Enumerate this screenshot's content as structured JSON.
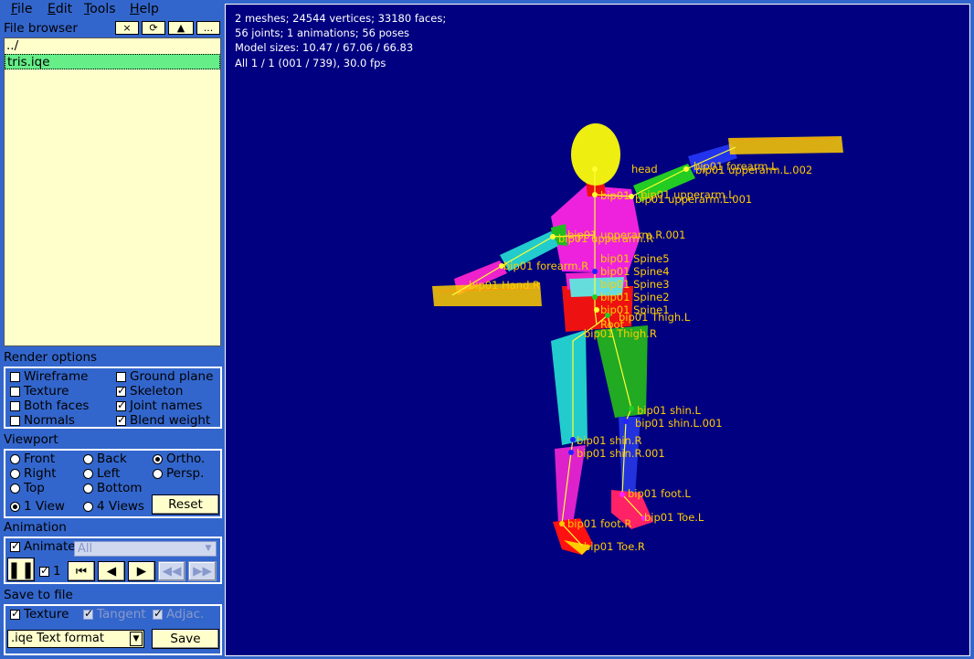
{
  "menu": {
    "file": "File",
    "edit": "Edit",
    "tools": "Tools",
    "help": "Help"
  },
  "file_browser": {
    "title": "File browser",
    "buttons": {
      "close": "×",
      "refresh": "⟳",
      "up": "▲",
      "more": "..."
    },
    "items": [
      "../",
      "tris.iqe"
    ],
    "selected": "tris.iqe"
  },
  "render_options": {
    "title": "Render options",
    "wireframe": "Wireframe",
    "ground_plane": "Ground plane",
    "texture": "Texture",
    "skeleton": "Skeleton",
    "both_faces": "Both faces",
    "joint_names": "Joint names",
    "normals": "Normals",
    "blend_weight": "Blend weight",
    "checked": {
      "wireframe": false,
      "ground_plane": false,
      "texture": false,
      "skeleton": true,
      "both_faces": false,
      "joint_names": true,
      "normals": false,
      "blend_weight": true
    }
  },
  "viewport": {
    "title": "Viewport",
    "front": "Front",
    "back": "Back",
    "ortho": "Ortho.",
    "right": "Right",
    "left": "Left",
    "persp": "Persp.",
    "top": "Top",
    "bottom": "Bottom",
    "one_view": "1 View",
    "four_views": "4 Views",
    "reset": "Reset",
    "selected_projection": "Ortho.",
    "selected_layout": "1 View"
  },
  "animation": {
    "title": "Animation",
    "animate_label": "Animate",
    "animate_checked": true,
    "select_value": "All",
    "speed_label": "1",
    "speed_checked": true
  },
  "save": {
    "title": "Save to file",
    "texture": "Texture",
    "texture_checked": true,
    "tangent": "Tangent",
    "tangent_checked": true,
    "adjac": "Adjac.",
    "adjac_checked": true,
    "format_value": ".iqe  Text format",
    "save_button": "Save"
  },
  "info": {
    "line1": "2 meshes; 24544 vertices; 33180 faces;",
    "line2": "56 joints; 1 animations; 56 poses",
    "line3": "Model sizes: 10.47 / 67.06 / 66.83",
    "line4": "All  1 / 1 (001 / 739), 30.0 fps"
  },
  "joint_labels": {
    "head": "head",
    "upperarm_l_002": "bip01 upperarm.L.002",
    "forearm_l": "bip01 forearm.L",
    "upperarm_l": "bip01 upperarm.L",
    "upperarm_l_001": "bip01 upperarm.L.001",
    "neck": "bip01",
    "upperarm_r_001": "bip01 upperarm.R.001",
    "upperarm_r": "bip01 upperarm.R",
    "forearm_r": "bip01 forearm.R",
    "spine5": "bip01 Spine5",
    "spine4": "bip01 Spine4",
    "spine3": "bip01 Spine3",
    "spine2": "bip01 Spine2",
    "spine1": "bip01 Spine1",
    "hand_r": "bip01 Hand.R",
    "thigh_l": "bip01 Thigh.L",
    "root": "Root",
    "thigh_r": "bip01 Thigh.R",
    "shin_l": "bip01 shin.L",
    "shin_l_001": "bip01 shin.L.001",
    "shin_r": "bip01 shin.R",
    "shin_r_001": "bip01 shin.R.001",
    "foot_l": "bip01 foot.L",
    "toe_l": "bip01 Toe.L",
    "foot_r": "bip01 foot.R",
    "toe_r": "bip01 Toe.R"
  },
  "colors": {
    "panel_bg": "#3366cc",
    "viewport_bg": "#000080",
    "list_bg": "#ffffcc",
    "selected_item": "#66ee88",
    "label_color": "#ffcc00"
  }
}
